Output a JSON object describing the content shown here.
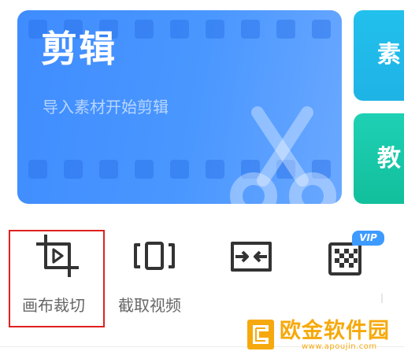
{
  "main_card": {
    "title": "剪辑",
    "subtitle": "导入素材开始剪辑"
  },
  "side_cards": [
    {
      "label": "素"
    },
    {
      "label": "教"
    }
  ],
  "tools": [
    {
      "label": "画布裁切",
      "icon": "crop-icon",
      "selected": true
    },
    {
      "label": "截取视频",
      "icon": "video-trim-icon"
    },
    {
      "label": "",
      "icon": "compress-icon"
    },
    {
      "label": "",
      "icon": "mosaic-icon",
      "badge": "VIP"
    }
  ],
  "watermark": {
    "text": "欧金软件园",
    "url": "www.apoujin.com"
  },
  "colors": {
    "main_card": "#4a97ff",
    "side_top": "#22c0ec",
    "side_bottom": "#12bf9c",
    "highlight": "#e02020",
    "vip": "#3d9bff",
    "watermark": "#f6a90c"
  }
}
